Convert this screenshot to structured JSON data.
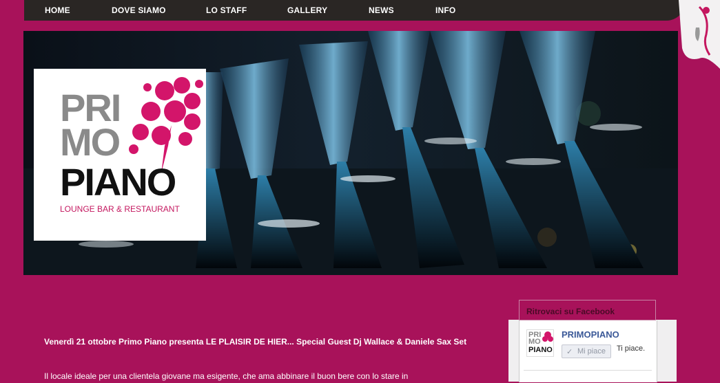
{
  "nav": {
    "items": [
      {
        "label": "HOME"
      },
      {
        "label": "DOVE SIAMO"
      },
      {
        "label": "LO STAFF"
      },
      {
        "label": "GALLERY"
      },
      {
        "label": "NEWS"
      },
      {
        "label": "INFO"
      }
    ]
  },
  "logo": {
    "line1": "PRI",
    "line2": "MO",
    "line3": "PIANO",
    "tagline": "LOUNGE BAR & RESTAURANT"
  },
  "article": {
    "title": "Venerdì 21 ottobre Primo Piano presenta LE PLAISIR DE HIER... Special Guest Dj Wallace & Daniele Sax Set",
    "body": "Il locale ideale per una clientela giovane ma esigente, che ama abbinare il buon bere con lo stare in"
  },
  "facebook": {
    "header": "Ritrovaci su Facebook",
    "page_name": "PRIMOPIANO",
    "like_button": "Mi piace",
    "like_text": "Ti piace.",
    "thumb_lines": [
      "PRI",
      "MO",
      "PIANO"
    ]
  },
  "colors": {
    "background": "#a8125a",
    "nav_bar": "#2a2624",
    "accent": "#c4175f",
    "facebook_blue": "#3b5998"
  }
}
